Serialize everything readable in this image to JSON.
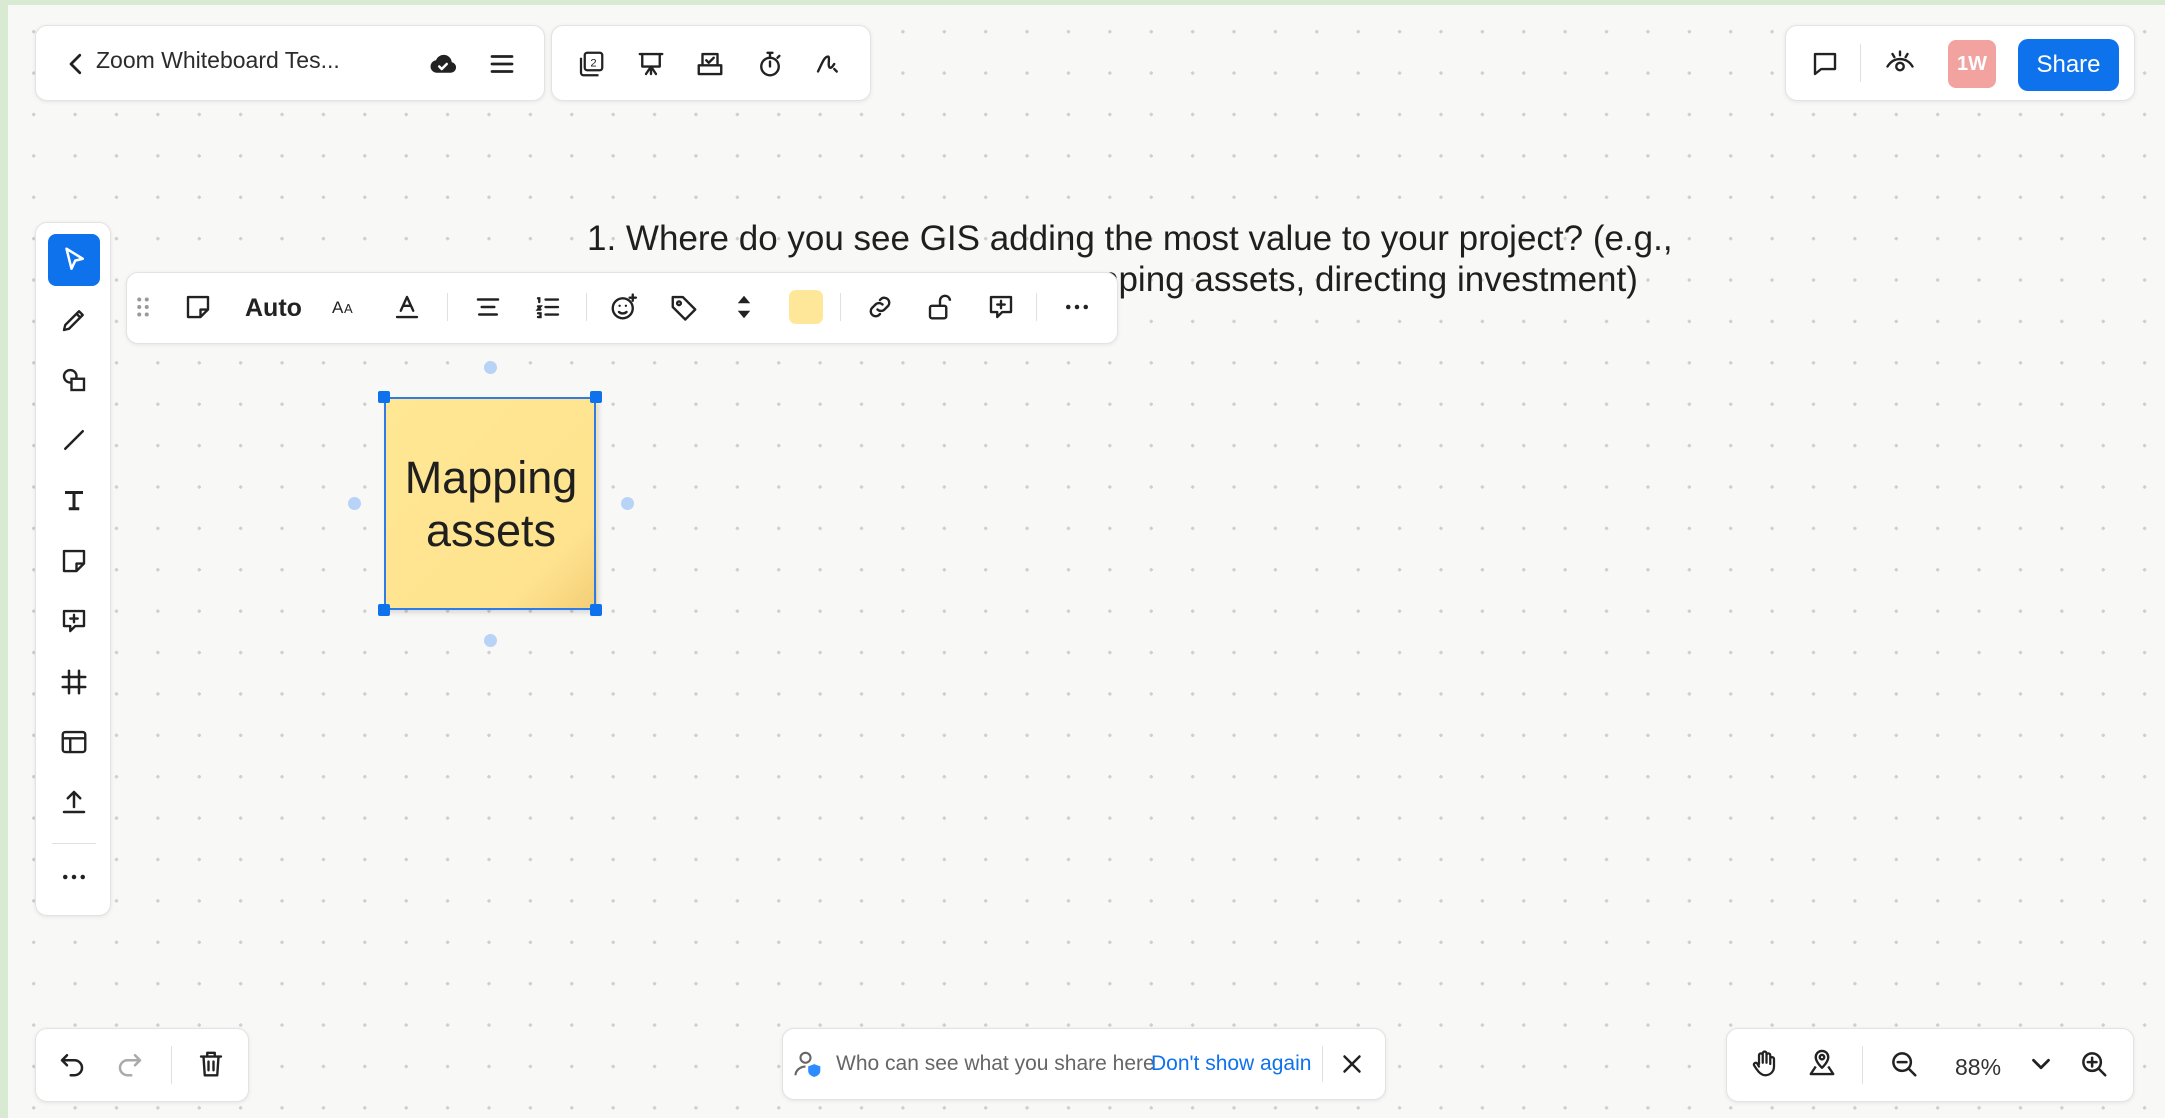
{
  "header": {
    "back_icon": "chevron-left-icon",
    "title": "Zoom Whiteboard Tes...",
    "cloud_icon": "cloud-saved-icon",
    "menu_icon": "hamburger-menu-icon",
    "page_count": "2"
  },
  "collab": {
    "avatar_initials": "1W",
    "share_label": "Share"
  },
  "context_toolbar": {
    "size_label": "Auto",
    "font_label": "Aa",
    "fill_color": "#ffe799"
  },
  "canvas": {
    "question_line1": "1. Where do you see GIS adding the most value to your project? (e.g.,",
    "question_line2": "pping assets, directing investment)",
    "sticky_text_line1": "Mapping",
    "sticky_text_line2": "assets",
    "sticky_color": "#ffe794"
  },
  "notice": {
    "text": "Who can see what you share here",
    "link_label": "Don't show again"
  },
  "zoom": {
    "level": "88%"
  },
  "colors": {
    "accent": "#0e72ed",
    "avatar_bg": "#f2a3a0"
  }
}
